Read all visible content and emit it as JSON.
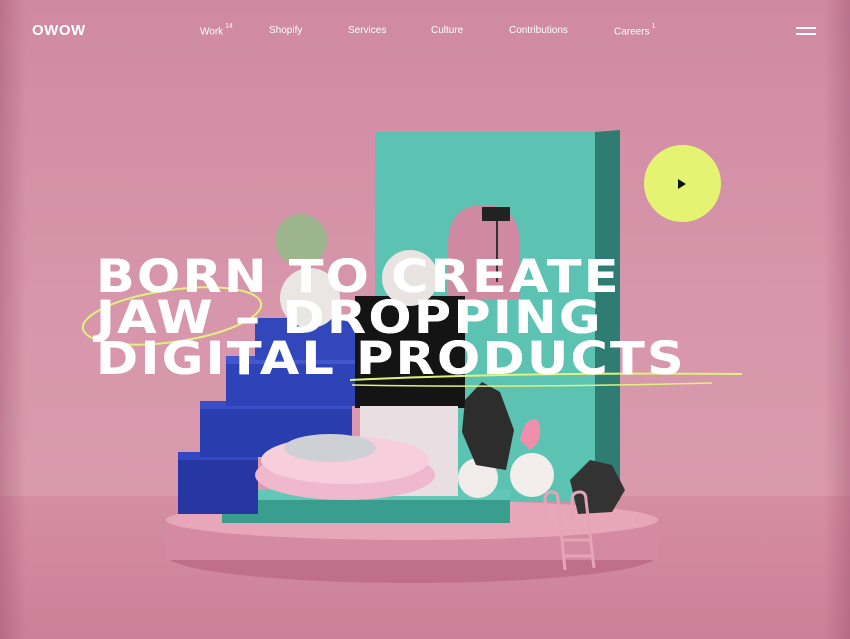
{
  "brand": {
    "logo": "OWOW"
  },
  "nav": {
    "items": [
      {
        "label": "Work",
        "count": "14"
      },
      {
        "label": "Shopify",
        "count": ""
      },
      {
        "label": "Services",
        "count": ""
      },
      {
        "label": "Culture",
        "count": ""
      },
      {
        "label": "Contributions",
        "count": ""
      },
      {
        "label": "Careers",
        "count": "1"
      }
    ]
  },
  "hero": {
    "lines": [
      "BORN TO CREATE",
      "JAW – DROPPING",
      "DIGITAL PRODUCTS"
    ]
  },
  "colors": {
    "background": "#d38fa6",
    "accent": "#e4f472",
    "teal": "#4fb6a4",
    "blue": "#2b3fb0"
  },
  "icons": {
    "play": "play-icon",
    "menu": "hamburger-icon"
  }
}
